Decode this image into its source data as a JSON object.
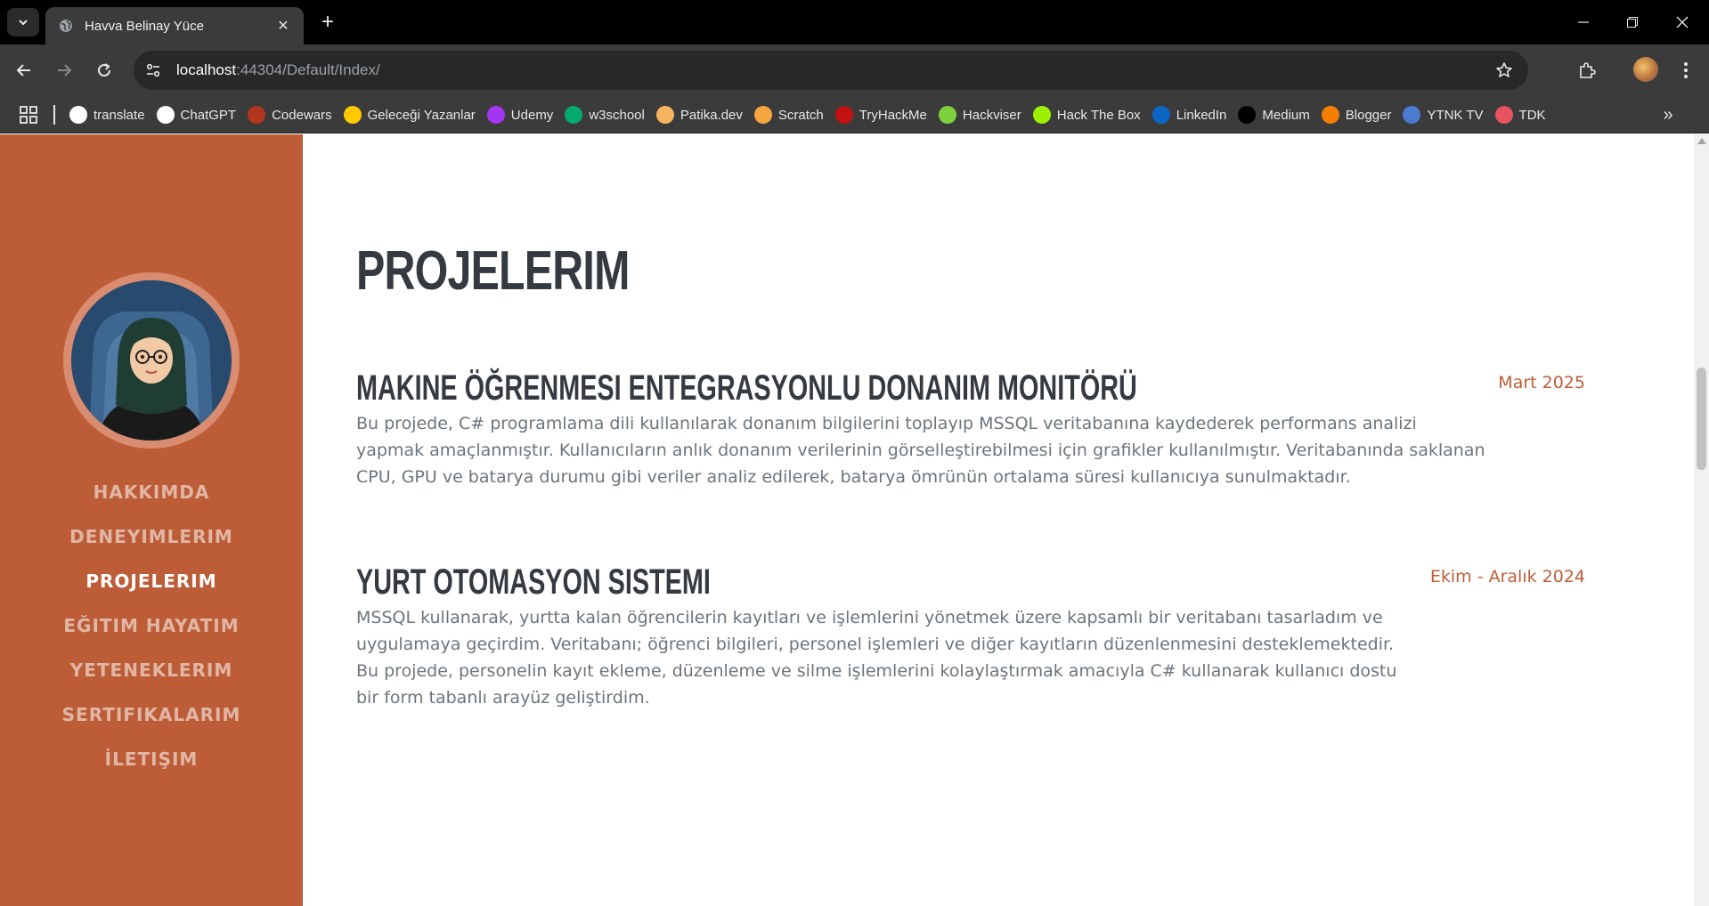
{
  "browser": {
    "tab_title": "Havva Belinay Yüce",
    "url_host": "localhost",
    "url_rest": ":44304/Default/Index/",
    "bookmarks": [
      {
        "label": "translate",
        "icon": "google-icon",
        "color": "#ffffff"
      },
      {
        "label": "ChatGPT",
        "icon": "chatgpt-icon",
        "color": "#ffffff"
      },
      {
        "label": "Codewars",
        "icon": "codewars-icon",
        "color": "#b1361e"
      },
      {
        "label": "Geleceği Yazanlar",
        "icon": "turkcell-icon",
        "color": "#ffc900"
      },
      {
        "label": "Udemy",
        "icon": "udemy-icon",
        "color": "#a435f0"
      },
      {
        "label": "w3school",
        "icon": "w3schools-icon",
        "color": "#04aa6d"
      },
      {
        "label": "Patika.dev",
        "icon": "patika-icon",
        "color": "#f4b45f"
      },
      {
        "label": "Scratch",
        "icon": "scratch-icon",
        "color": "#f7a541"
      },
      {
        "label": "TryHackMe",
        "icon": "tryhackme-icon",
        "color": "#c11111"
      },
      {
        "label": "Hackviser",
        "icon": "hackviser-icon",
        "color": "#7fd13b"
      },
      {
        "label": "Hack The Box",
        "icon": "hackthebox-icon",
        "color": "#9fef00"
      },
      {
        "label": "LinkedIn",
        "icon": "linkedin-icon",
        "color": "#0a66c2"
      },
      {
        "label": "Medium",
        "icon": "medium-icon",
        "color": "#000000"
      },
      {
        "label": "Blogger",
        "icon": "blogger-icon",
        "color": "#f57d00"
      },
      {
        "label": "YTNK TV",
        "icon": "ytnk-icon",
        "color": "#4a7bd0"
      },
      {
        "label": "TDK",
        "icon": "tdk-icon",
        "color": "#e5535f"
      }
    ]
  },
  "sidebar": {
    "accent": "#bd5d38",
    "nav": [
      {
        "label": "HAKKIMDA",
        "active": false
      },
      {
        "label": "DENEYIMLERIM",
        "active": false
      },
      {
        "label": "PROJELERIM",
        "active": true
      },
      {
        "label": "EĞITIM HAYATIM",
        "active": false
      },
      {
        "label": "YETENEKLERIM",
        "active": false
      },
      {
        "label": "SERTIFIKALARIM",
        "active": false
      },
      {
        "label": "İLETIŞIM",
        "active": false
      }
    ]
  },
  "main": {
    "title": "PROJELERIM",
    "projects": [
      {
        "title": "MAKINE ÖĞRENMESI ENTEGRASYONLU DONANIM MONITÖRÜ",
        "date": "Mart 2025",
        "description": "Bu projede, C# programlama dili kullanılarak donanım bilgilerini toplayıp MSSQL veritabanına kaydederek performans analizi yapmak amaçlanmıştır. Kullanıcıların anlık donanım verilerinin görselleştirebilmesi için grafikler kullanılmıştır. Veritabanında saklanan CPU, GPU ve batarya durumu gibi veriler analiz edilerek, batarya ömrünün ortalama süresi kullanıcıya sunulmaktadır."
      },
      {
        "title": "YURT OTOMASYON SISTEMI",
        "date": "Ekim - Aralık 2024",
        "description": "MSSQL kullanarak, yurtta kalan öğrencilerin kayıtları ve işlemlerini yönetmek üzere kapsamlı bir veritabanı tasarladım ve uygulamaya geçirdim. Veritabanı; öğrenci bilgileri, personel işlemleri ve diğer kayıtların düzenlenmesini desteklemektedir. Bu projede, personelin kayıt ekleme, düzenleme ve silme işlemlerini kolaylaştırmak amacıyla C# kullanarak kullanıcı dostu bir form tabanlı arayüz geliştirdim."
      }
    ]
  }
}
